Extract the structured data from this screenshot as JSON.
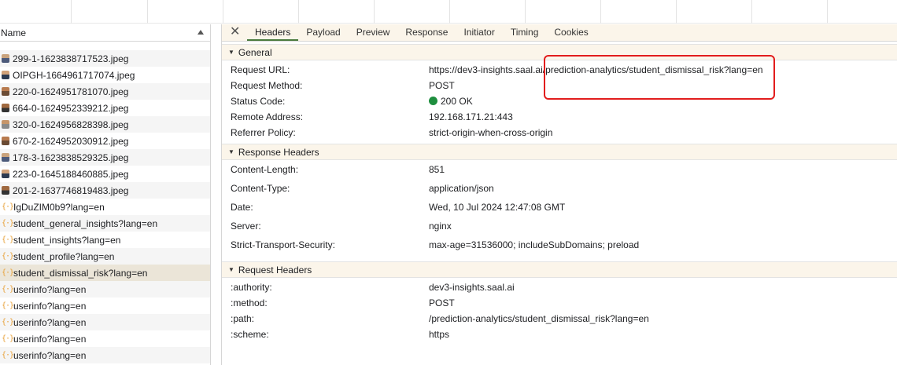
{
  "left": {
    "header": "Name",
    "items": [
      {
        "label": "299-1-1623838717523.jpeg",
        "kind": "image",
        "thumb": "t0"
      },
      {
        "label": "OIPGH-1664961717074.jpeg",
        "kind": "image",
        "thumb": "t1"
      },
      {
        "label": "220-0-1624951781070.jpeg",
        "kind": "image",
        "thumb": "t2"
      },
      {
        "label": "664-0-1624952339212.jpeg",
        "kind": "image",
        "thumb": "t3"
      },
      {
        "label": "320-0-1624956828398.jpeg",
        "kind": "image",
        "thumb": "t4"
      },
      {
        "label": "670-2-1624952030912.jpeg",
        "kind": "image",
        "thumb": "t2"
      },
      {
        "label": "178-3-1623838529325.jpeg",
        "kind": "image",
        "thumb": "t0"
      },
      {
        "label": "223-0-1645188460885.jpeg",
        "kind": "image",
        "thumb": "t1"
      },
      {
        "label": "201-2-1637746819483.jpeg",
        "kind": "image",
        "thumb": "t3"
      },
      {
        "label": "IgDuZIM0b9?lang=en",
        "kind": "xhr"
      },
      {
        "label": "student_general_insights?lang=en",
        "kind": "xhr"
      },
      {
        "label": "student_insights?lang=en",
        "kind": "xhr"
      },
      {
        "label": "student_profile?lang=en",
        "kind": "xhr"
      },
      {
        "label": "student_dismissal_risk?lang=en",
        "kind": "xhr",
        "selected": true
      },
      {
        "label": "userinfo?lang=en",
        "kind": "xhr"
      },
      {
        "label": "userinfo?lang=en",
        "kind": "xhr"
      },
      {
        "label": "userinfo?lang=en",
        "kind": "xhr"
      },
      {
        "label": "userinfo?lang=en",
        "kind": "xhr"
      },
      {
        "label": "userinfo?lang=en",
        "kind": "xhr"
      }
    ]
  },
  "tabs": {
    "close": "✕",
    "items": [
      "Headers",
      "Payload",
      "Preview",
      "Response",
      "Initiator",
      "Timing",
      "Cookies"
    ],
    "active": "Headers"
  },
  "general": {
    "title": "General",
    "rows": [
      {
        "key": "Request URL:",
        "value": "https://dev3-insights.saal.ai/prediction-analytics/student_dismissal_risk?lang=en"
      },
      {
        "key": "Request Method:",
        "value": "POST"
      },
      {
        "key": "Status Code:",
        "value": "200 OK",
        "status_color": "#1e8e3e"
      },
      {
        "key": "Remote Address:",
        "value": "192.168.171.21:443"
      },
      {
        "key": "Referrer Policy:",
        "value": "strict-origin-when-cross-origin"
      }
    ]
  },
  "response_headers": {
    "title": "Response Headers",
    "rows": [
      {
        "key": "Content-Length:",
        "value": "851"
      },
      {
        "key": "Content-Type:",
        "value": "application/json"
      },
      {
        "key": "Date:",
        "value": "Wed, 10 Jul 2024 12:47:08 GMT"
      },
      {
        "key": "Server:",
        "value": "nginx"
      },
      {
        "key": "Strict-Transport-Security:",
        "value": "max-age=31536000; includeSubDomains; preload"
      }
    ]
  },
  "request_headers": {
    "title": "Request Headers",
    "rows": [
      {
        "key": ":authority:",
        "value": "dev3-insights.saal.ai"
      },
      {
        "key": ":method:",
        "value": "POST"
      },
      {
        "key": ":path:",
        "value": "/prediction-analytics/student_dismissal_risk?lang=en"
      },
      {
        "key": ":scheme:",
        "value": "https"
      }
    ]
  },
  "colors": {
    "accent": "#4a7a3d",
    "highlight": "#e21d1d",
    "selected_row": "#ebe5d8"
  }
}
